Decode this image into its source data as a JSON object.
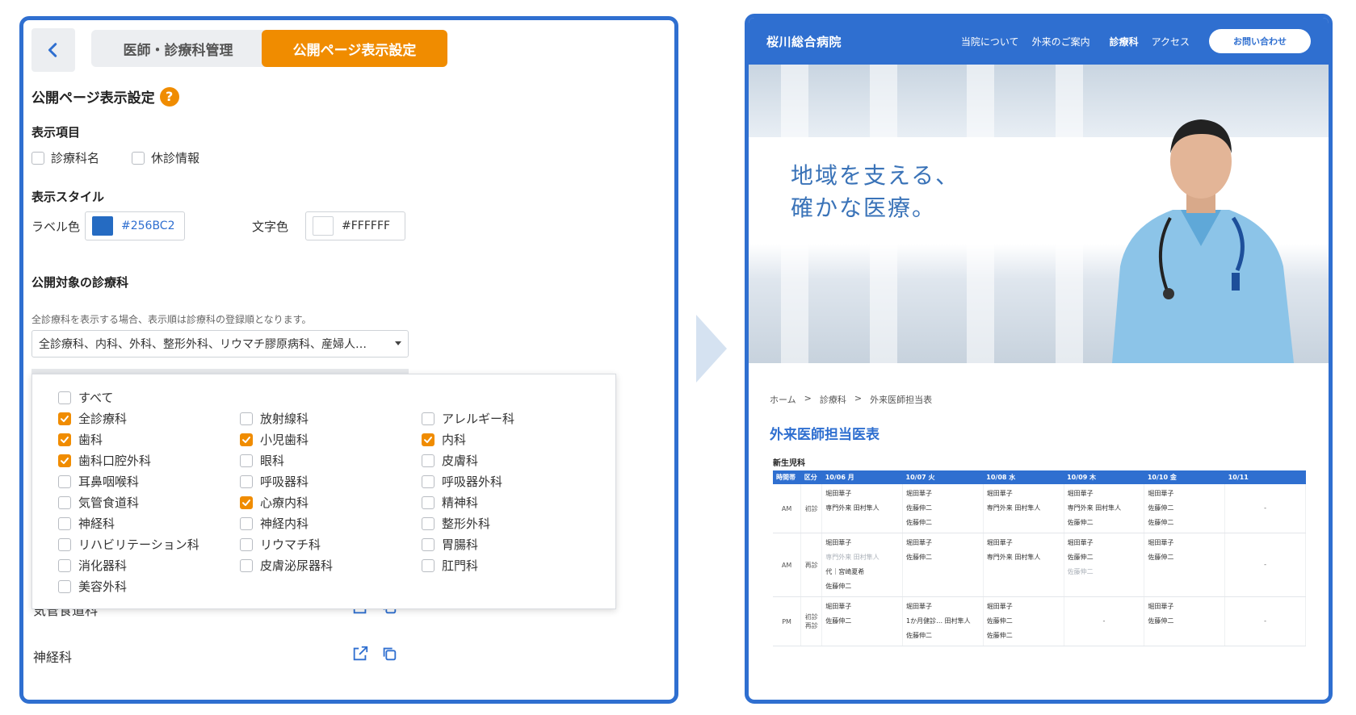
{
  "left": {
    "tabs": {
      "clinic": "医師・診療科管理",
      "public": "公開ページ表示設定"
    },
    "section_title": "公開ページ表示設定",
    "help": "?",
    "display_items": {
      "title": "表示項目",
      "options": [
        {
          "label": "診療科名",
          "checked": false
        },
        {
          "label": "休診情報",
          "checked": false
        }
      ]
    },
    "style": {
      "title": "表示スタイル",
      "label_color_label": "ラベル色",
      "label_color_value": "#256BC2",
      "text_color_label": "文字色",
      "text_color_value": "#FFFFFF"
    },
    "target": {
      "title": "公開対象の診療科",
      "note": "全診療科を表示する場合、表示順は診療科の登録順となります。",
      "selected": "全診療科、内科、外科、整形外科、リウマチ膠原病科、産婦人…"
    },
    "departments": [
      {
        "label": "すべて",
        "checked": false
      },
      {
        "label": "全診療科",
        "checked": true
      },
      {
        "label": "放射線科",
        "checked": false
      },
      {
        "label": "アレルギー科",
        "checked": false
      },
      {
        "label": "歯科",
        "checked": true
      },
      {
        "label": "小児歯科",
        "checked": true
      },
      {
        "label": "内科",
        "checked": true
      },
      {
        "label": "歯科口腔外科",
        "checked": true
      },
      {
        "label": "眼科",
        "checked": false
      },
      {
        "label": "皮膚科",
        "checked": false
      },
      {
        "label": "耳鼻咽喉科",
        "checked": false
      },
      {
        "label": "呼吸器科",
        "checked": false
      },
      {
        "label": "呼吸器外科",
        "checked": false
      },
      {
        "label": "気管食道科",
        "checked": false
      },
      {
        "label": "心療内科",
        "checked": true
      },
      {
        "label": "精神科",
        "checked": false
      },
      {
        "label": "神経科",
        "checked": false
      },
      {
        "label": "神経内科",
        "checked": false
      },
      {
        "label": "整形外科",
        "checked": false
      },
      {
        "label": "リハビリテーション科",
        "checked": false
      },
      {
        "label": "リウマチ科",
        "checked": false
      },
      {
        "label": "胃腸科",
        "checked": false
      },
      {
        "label": "消化器科",
        "checked": false
      },
      {
        "label": "皮膚泌尿器科",
        "checked": false
      },
      {
        "label": "肛門科",
        "checked": false
      },
      {
        "label": "美容外科",
        "checked": false
      }
    ],
    "rows_behind": {
      "partial": "気管食道科",
      "row": "神経科"
    }
  },
  "right": {
    "logo": "桜川総合病院",
    "nav": [
      "当院について",
      "外来のご案内",
      "診療科",
      "アクセス"
    ],
    "contact": "お問い合わせ",
    "hero_line1": "地域を支える、",
    "hero_line2": "確かな医療。",
    "breadcrumb": [
      "ホーム",
      ">",
      "診療科",
      ">",
      "外来医師担当表"
    ],
    "page_title": "外来医師担当医表",
    "dept": "新生児科",
    "table": {
      "headers": [
        "時間帯",
        "区分",
        "10/06 月",
        "10/07 火",
        "10/08 水",
        "10/09 木",
        "10/10 金",
        "10/11"
      ],
      "rows": [
        {
          "time": "AM",
          "kind": "初診",
          "cells": [
            [
              "堀田華子",
              "専門外来 田村隼人"
            ],
            [
              "堀田華子",
              "佐藤伸二",
              "佐藤伸二"
            ],
            [
              "堀田華子",
              "専門外来 田村隼人"
            ],
            [
              "堀田華子",
              "専門外来 田村隼人",
              "佐藤伸二"
            ],
            [
              "堀田華子",
              "佐藤伸二",
              "佐藤伸二"
            ],
            [
              "-"
            ]
          ]
        },
        {
          "time": "AM",
          "kind": "再診",
          "cells": [
            [
              "堀田華子",
              "専門外来 田村隼人",
              "代｜宮崎夏希",
              "佐藤伸二"
            ],
            [
              "堀田華子",
              "佐藤伸二"
            ],
            [
              "堀田華子",
              "専門外来 田村隼人"
            ],
            [
              "堀田華子",
              "佐藤伸二",
              "佐藤伸二"
            ],
            [
              "堀田華子",
              "佐藤伸二"
            ],
            [
              "-"
            ]
          ]
        },
        {
          "time": "PM",
          "kind": "初診 再診",
          "cells": [
            [
              "堀田華子",
              "佐藤伸二"
            ],
            [
              "堀田華子",
              "1か月健診… 田村隼人",
              "佐藤伸二"
            ],
            [
              "堀田華子",
              "佐藤伸二",
              "佐藤伸二"
            ],
            [
              "-"
            ],
            [
              "堀田華子",
              "佐藤伸二"
            ],
            [
              "-"
            ]
          ]
        }
      ]
    }
  },
  "colors": {
    "accent": "#2f6fd0",
    "orange": "#f08c00",
    "label_swatch": "#256BC2"
  }
}
